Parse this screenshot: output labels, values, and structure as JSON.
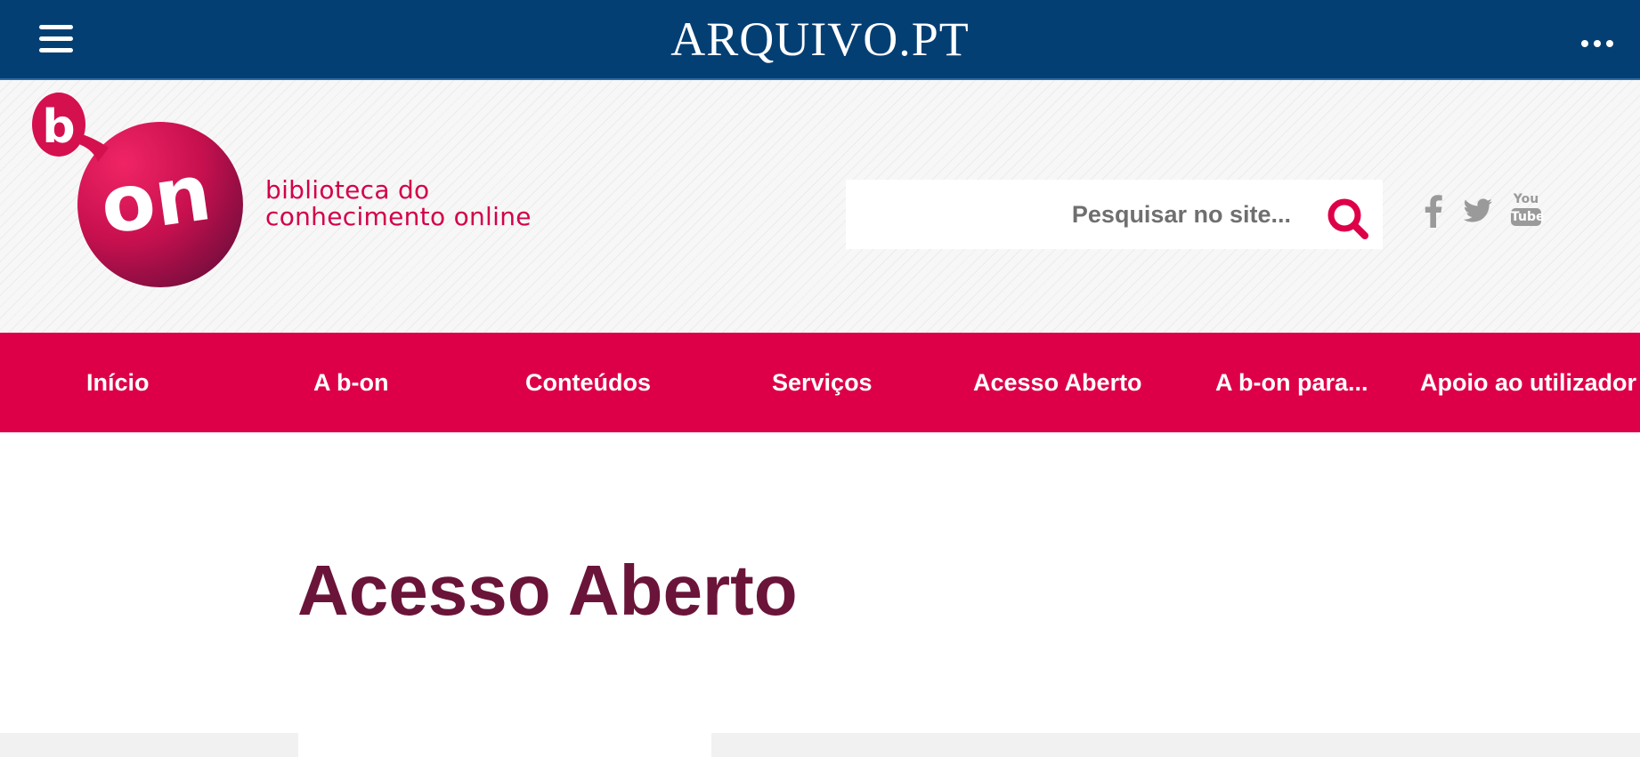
{
  "topbar": {
    "menu_icon": "hamburger-menu-icon",
    "brand": "ARQUIVO.PT",
    "more_icon": "more-dots-icon"
  },
  "header": {
    "logo_text_b": "b",
    "logo_text_on": "on",
    "tagline_line1": "biblioteca do",
    "tagline_line2": "conhecimento online",
    "search": {
      "placeholder": "Pesquisar no site...",
      "icon": "search-icon"
    },
    "social": [
      {
        "name": "facebook",
        "icon": "facebook-icon"
      },
      {
        "name": "twitter",
        "icon": "twitter-icon"
      },
      {
        "name": "youtube",
        "icon": "youtube-icon",
        "label_top": "You",
        "label_bottom": "Tube"
      }
    ]
  },
  "nav": {
    "items": [
      {
        "label": "Início"
      },
      {
        "label": "A b-on"
      },
      {
        "label": "Conteúdos"
      },
      {
        "label": "Serviços"
      },
      {
        "label": "Acesso Aberto"
      },
      {
        "label": "A b-on para..."
      },
      {
        "label": "Apoio ao utilizador"
      }
    ]
  },
  "main": {
    "title": "Acesso Aberto"
  },
  "colors": {
    "topbar": "#043f74",
    "brand_pink": "#dd0048",
    "title_maroon": "#6b1439",
    "icon_gray": "#9a9a9a"
  }
}
